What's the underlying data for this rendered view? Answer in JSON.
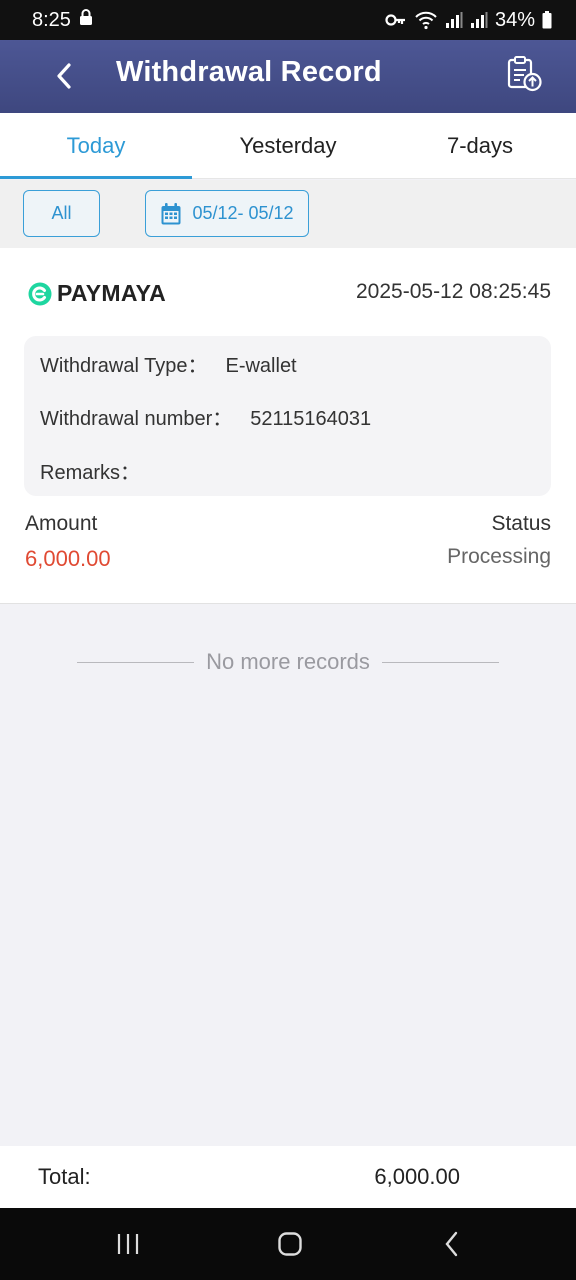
{
  "status_bar": {
    "time": "8:25",
    "battery": "34%"
  },
  "header": {
    "title": "Withdrawal Record"
  },
  "tabs": [
    {
      "label": "Today",
      "active": true
    },
    {
      "label": "Yesterday",
      "active": false
    },
    {
      "label": "7-days",
      "active": false
    }
  ],
  "filters": {
    "all_label": "All",
    "date_range": "05/12- 05/12"
  },
  "record": {
    "brand": "PAYMAYA",
    "datetime": "2025-05-12 08:25:45",
    "type_label": "Withdrawal Type：",
    "type_value": "E-wallet",
    "number_label": "Withdrawal number：",
    "number_value": "52115164031",
    "remarks_label": "Remarks：",
    "remarks_value": "",
    "amount_label": "Amount",
    "amount_value": "6,000.00",
    "status_label": "Status",
    "status_value": "Processing"
  },
  "list_end": "No more records",
  "footer": {
    "total_label": "Total:",
    "total_value": "6,000.00"
  },
  "colors": {
    "header": "#454f8a",
    "accent": "#2d9ad6",
    "amount": "#e04a33",
    "paymaya": "#1ed6a0"
  }
}
